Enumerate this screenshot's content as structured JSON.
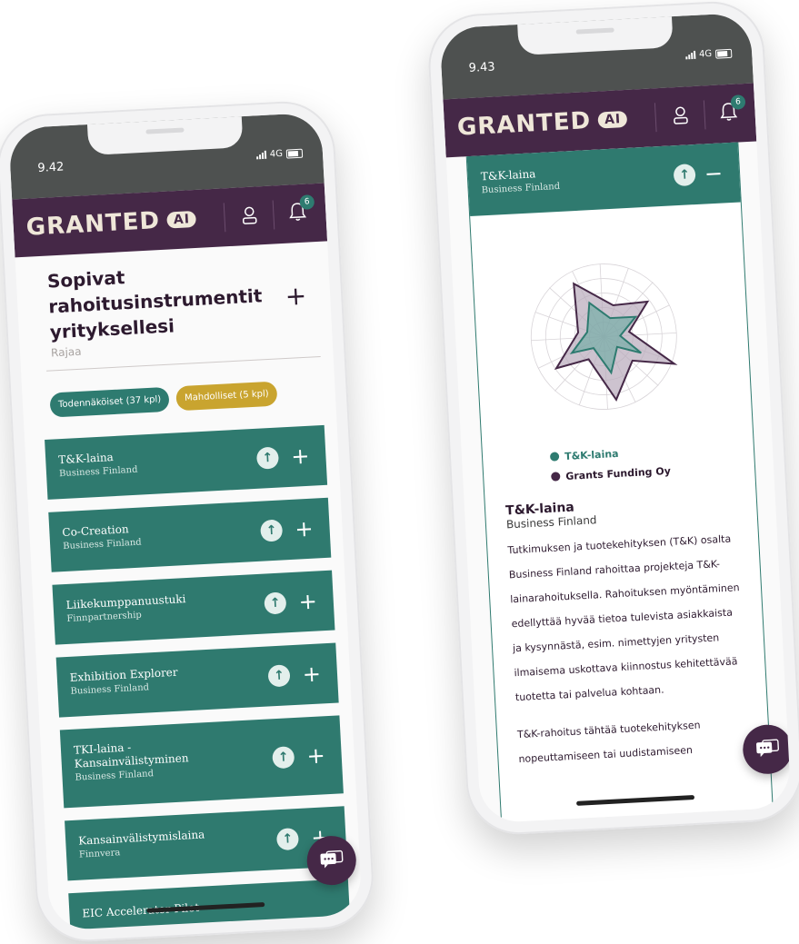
{
  "left": {
    "time": "9.42",
    "network": "4G",
    "logo": {
      "text": "GRANTED",
      "ai": "AI"
    },
    "notifications": "6",
    "headline": "Sopivat rahoitusinstrumentit yrityksellesi",
    "filter_label": "Rajaa",
    "plus": "+",
    "chips": {
      "probable": "Todennäköiset (37 kpl)",
      "possible": "Mahdolliset (5 kpl)"
    },
    "cards": [
      {
        "title": "T&K-laina",
        "provider": "Business Finland"
      },
      {
        "title": "Co-Creation",
        "provider": "Business Finland"
      },
      {
        "title": "Liikekumppanuustuki",
        "provider": "Finnpartnership"
      },
      {
        "title": "Exhibition Explorer",
        "provider": "Business Finland"
      },
      {
        "title": "TKI-laina - Kansainvälistyminen",
        "provider": "Business Finland"
      },
      {
        "title": "Kansainvälistymislaina",
        "provider": "Finnvera"
      },
      {
        "title": "EIC Accelerator Pilot",
        "provider": ""
      }
    ]
  },
  "right": {
    "time": "9.43",
    "network": "4G",
    "logo": {
      "text": "GRANTED",
      "ai": "AI"
    },
    "notifications": "6",
    "header": {
      "title": "T&K-laina",
      "provider": "Business Finland"
    },
    "legend": [
      {
        "label": "T&K-laina",
        "color": "#2e7b70"
      },
      {
        "label": "Grants Funding Oy",
        "color": "#452847"
      }
    ],
    "detail_title": "T&K-laina",
    "detail_provider": "Business Finland",
    "paragraph1": "Tutkimuksen ja tuotekehityksen (T&K) osalta Business Finland rahoittaa projekteja T&K-lainarahoituksella. Rahoituksen myöntäminen edellyttää hyvää tietoa tulevista asiakkaista ja kysynnästä, esim. nimettyjen yritysten ilmaisema uskottava kiinnostus kehitettävää tuotetta tai palvelua kohtaan.",
    "paragraph2": "T&K-rahoitus tähtää tuotekehityksen nopeuttamiseen tai uudistamiseen"
  },
  "colors": {
    "brand_purple": "#452847",
    "teal": "#2f7a6f",
    "gold": "#c9a42f"
  }
}
